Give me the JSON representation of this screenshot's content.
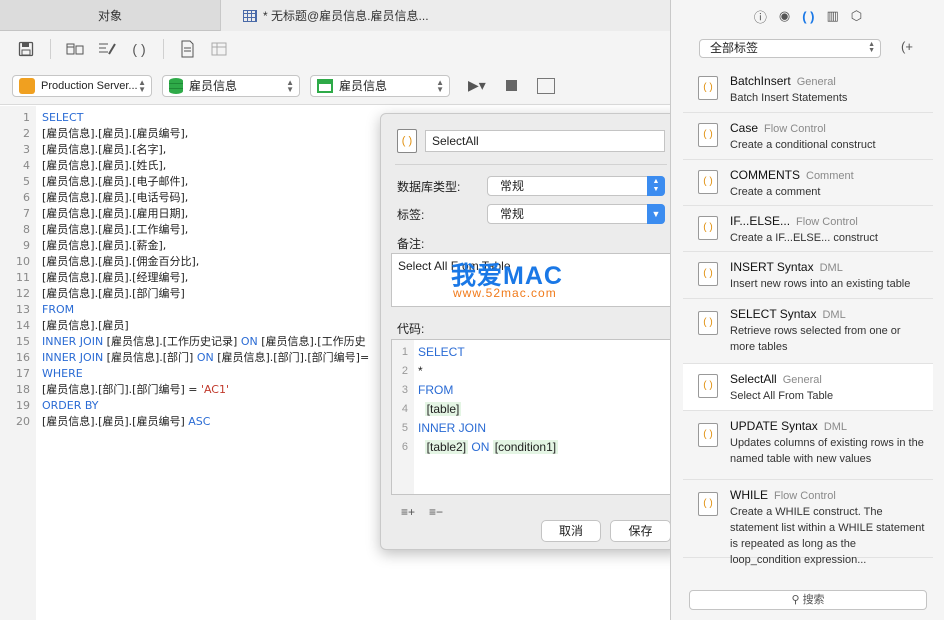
{
  "tabs": {
    "objects_label": "对象",
    "query_label": "* 无标题@雇员信息.雇员信息..."
  },
  "toolbar": {
    "icons": [
      "save-icon",
      "query-builder-icon",
      "beautify-icon",
      "code-snippet-icon",
      "export-icon",
      "grid-icon"
    ]
  },
  "selectors": {
    "connection": "Production Server...",
    "database": "雇员信息",
    "schema": "雇员信息"
  },
  "editor": {
    "lines": [
      {
        "n": "1",
        "parts": [
          [
            "kw",
            "SELECT"
          ]
        ]
      },
      {
        "n": "2",
        "parts": [
          [
            "",
            "[雇员信息].[雇员].[雇员编号],"
          ]
        ]
      },
      {
        "n": "3",
        "parts": [
          [
            "",
            "[雇员信息].[雇员].[名字],"
          ]
        ]
      },
      {
        "n": "4",
        "parts": [
          [
            "",
            "[雇员信息].[雇员].[姓氏],"
          ]
        ]
      },
      {
        "n": "5",
        "parts": [
          [
            "",
            "[雇员信息].[雇员].[电子邮件],"
          ]
        ]
      },
      {
        "n": "6",
        "parts": [
          [
            "",
            "[雇员信息].[雇员].[电话号码],"
          ]
        ]
      },
      {
        "n": "7",
        "parts": [
          [
            "",
            "[雇员信息].[雇员].[雇用日期],"
          ]
        ]
      },
      {
        "n": "8",
        "parts": [
          [
            "",
            "[雇员信息].[雇员].[工作编号],"
          ]
        ]
      },
      {
        "n": "9",
        "parts": [
          [
            "",
            "[雇员信息].[雇员].[薪金],"
          ]
        ]
      },
      {
        "n": "10",
        "parts": [
          [
            "",
            "[雇员信息].[雇员].[佣金百分比],"
          ]
        ]
      },
      {
        "n": "11",
        "parts": [
          [
            "",
            "[雇员信息].[雇员].[经理编号],"
          ]
        ]
      },
      {
        "n": "12",
        "parts": [
          [
            "",
            "[雇员信息].[雇员].[部门编号]"
          ]
        ]
      },
      {
        "n": "13",
        "parts": [
          [
            "kw",
            "FROM"
          ]
        ]
      },
      {
        "n": "14",
        "parts": [
          [
            "",
            "[雇员信息].[雇员]"
          ]
        ]
      },
      {
        "n": "15",
        "parts": [
          [
            "kw",
            "INNER JOIN"
          ],
          [
            "",
            " [雇员信息].[工作历史记录] "
          ],
          [
            "kw",
            "ON"
          ],
          [
            "",
            " [雇员信息].[工作历史"
          ]
        ]
      },
      {
        "n": "16",
        "parts": [
          [
            "kw",
            "INNER JOIN"
          ],
          [
            "",
            " [雇员信息].[部门] "
          ],
          [
            "kw",
            "ON"
          ],
          [
            "",
            " [雇员信息].[部门].[部门编号]="
          ]
        ]
      },
      {
        "n": "17",
        "parts": [
          [
            "kw",
            "WHERE"
          ]
        ]
      },
      {
        "n": "18",
        "parts": [
          [
            "",
            "[雇员信息].[部门].[部门编号] = "
          ],
          [
            "str",
            "'AC1'"
          ]
        ]
      },
      {
        "n": "19",
        "parts": [
          [
            "kw",
            "ORDER BY"
          ]
        ]
      },
      {
        "n": "20",
        "parts": [
          [
            "",
            "[雇员信息].[雇员].[雇员编号] "
          ],
          [
            "kw",
            "ASC"
          ]
        ]
      }
    ]
  },
  "popover": {
    "name_value": "SelectAll",
    "db_type_label": "数据库类型:",
    "db_type_value": "常规",
    "tag_label": "标签:",
    "tag_value": "常规",
    "comment_label": "备注:",
    "comment_value": "Select All From Table",
    "code_label": "代码:",
    "code_lines": [
      {
        "n": "1",
        "parts": [
          [
            "kw",
            "SELECT"
          ]
        ]
      },
      {
        "n": "2",
        "parts": [
          [
            "",
            "*"
          ]
        ]
      },
      {
        "n": "3",
        "parts": [
          [
            "kw",
            "FROM"
          ]
        ]
      },
      {
        "n": "4",
        "parts": [
          [
            "",
            "  "
          ],
          [
            "ph",
            "[table]"
          ]
        ]
      },
      {
        "n": "5",
        "parts": [
          [
            "kw",
            "INNER JOIN"
          ]
        ]
      },
      {
        "n": "6",
        "parts": [
          [
            "",
            "  "
          ],
          [
            "ph",
            "[table2]"
          ],
          [
            "",
            " "
          ],
          [
            "kw",
            "ON"
          ],
          [
            "",
            " "
          ],
          [
            "ph",
            "[condition1]"
          ]
        ]
      }
    ],
    "cancel_label": "取消",
    "save_label": "保存",
    "watermark_title": "我爱MAC",
    "watermark_url": "www.52mac.com"
  },
  "right_panel": {
    "filter_value": "全部标签",
    "search_placeholder": "搜索",
    "snippets": [
      {
        "title": "BatchInsert",
        "category": "General",
        "desc": "Batch Insert Statements"
      },
      {
        "title": "Case",
        "category": "Flow Control",
        "desc": "Create a conditional construct"
      },
      {
        "title": "COMMENTS",
        "category": "Comment",
        "desc": "Create a comment"
      },
      {
        "title": "IF...ELSE...",
        "category": "Flow Control",
        "desc": "Create a IF...ELSE... construct"
      },
      {
        "title": "INSERT Syntax",
        "category": "DML",
        "desc": "Insert new rows into an existing table"
      },
      {
        "title": "SELECT Syntax",
        "category": "DML",
        "desc": "Retrieve rows selected from one or more tables"
      },
      {
        "title": "SelectAll",
        "category": "General",
        "desc": "Select All From Table"
      },
      {
        "title": "UPDATE Syntax",
        "category": "DML",
        "desc": "Updates columns of existing rows in the named table with new values"
      },
      {
        "title": "WHILE",
        "category": "Flow Control",
        "desc": "Create a WHILE construct. The statement list within a WHILE statement is repeated as long as the loop_condition expression..."
      }
    ]
  },
  "colors": {
    "keyword": "#2a6bd4",
    "string": "#c0392b",
    "accent": "#1a78e6"
  }
}
